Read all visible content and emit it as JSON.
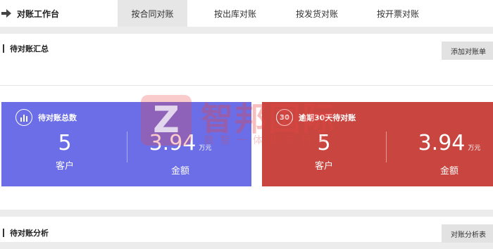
{
  "topbar": {
    "workbench_title": "对账工作台",
    "tabs": [
      {
        "label": "按合同对账",
        "active": true
      },
      {
        "label": "按出库对账",
        "active": false
      },
      {
        "label": "按发货对账",
        "active": false
      },
      {
        "label": "按开票对账",
        "active": false
      }
    ]
  },
  "summary": {
    "title": "待对账汇总",
    "button": "添加对账单",
    "cards": [
      {
        "title": "待对账总数",
        "icon": "bar-chart-icon",
        "color": "#6b6ee6",
        "customers": {
          "value": "5",
          "label": "客户"
        },
        "amount": {
          "value": "3.94",
          "unit": "万元",
          "label": "金额"
        }
      },
      {
        "title": "逾期30天待对账",
        "icon_text": "30",
        "color": "#c8463f",
        "customers": {
          "value": "5",
          "label": "客户"
        },
        "amount": {
          "value": "3.94",
          "unit": "万元",
          "label": "金额"
        }
      }
    ]
  },
  "analysis": {
    "title": "待对账分析",
    "button": "对账分析表"
  },
  "watermark": {
    "brand": "智邦国际",
    "slogan": "数智一体化先行者"
  }
}
